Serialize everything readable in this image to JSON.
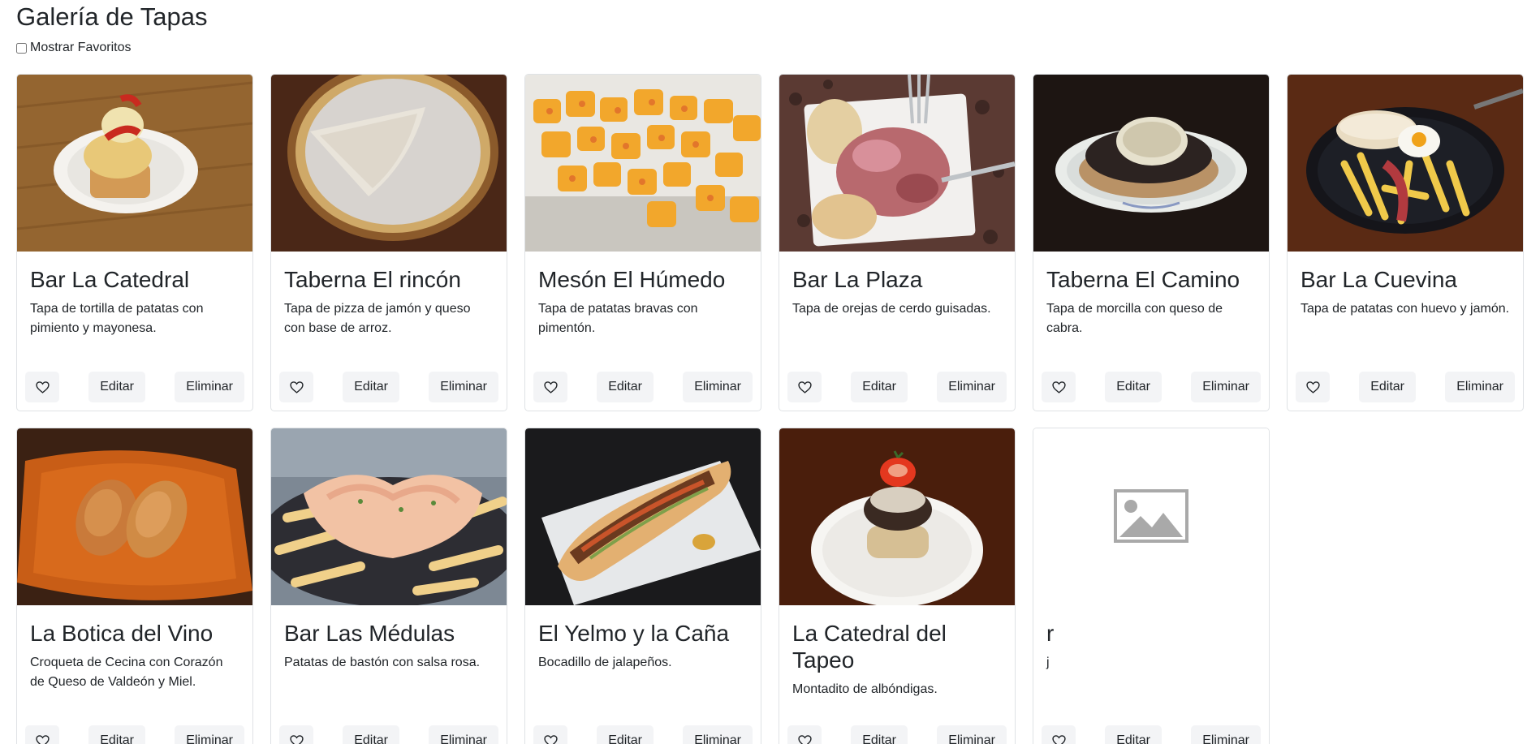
{
  "page": {
    "title": "Galería de Tapas",
    "favorites_filter_label": "Mostrar Favoritos",
    "favorites_filter_checked": false
  },
  "buttons": {
    "favorite_icon": "heart-outline-icon",
    "edit_label": "Editar",
    "delete_label": "Eliminar"
  },
  "cards": [
    {
      "name": "Bar La Catedral",
      "description": "Tapa de tortilla de patatas con pimiento y mayonesa.",
      "image": "tortilla-tapa-photo"
    },
    {
      "name": "Taberna El rincón",
      "description": "Tapa de pizza de jamón y queso con base de arroz.",
      "image": "pizza-tapa-photo"
    },
    {
      "name": "Mesón El Húmedo",
      "description": "Tapa de patatas bravas con pimentón.",
      "image": "patatas-bravas-photo"
    },
    {
      "name": "Bar La Plaza",
      "description": "Tapa de orejas de cerdo guisadas.",
      "image": "orejas-de-cerdo-photo"
    },
    {
      "name": "Taberna El Camino",
      "description": "Tapa de morcilla con queso de cabra.",
      "image": "morcilla-queso-photo"
    },
    {
      "name": "Bar La Cuevina",
      "description": "Tapa de patatas con huevo y jamón.",
      "image": "patatas-huevo-jamon-photo"
    },
    {
      "name": "La Botica del Vino",
      "description": "Croqueta de Cecina con Corazón de Queso de Valdeón y Miel.",
      "image": "croquetas-photo"
    },
    {
      "name": "Bar Las Médulas",
      "description": "Patatas de bastón con salsa rosa.",
      "image": "patatas-salsa-rosa-photo"
    },
    {
      "name": "El Yelmo y la Caña",
      "description": "Bocadillo de jalapeños.",
      "image": "bocadillo-photo"
    },
    {
      "name": "La Catedral del Tapeo",
      "description": "Montadito de albóndigas.",
      "image": "montadito-photo"
    },
    {
      "name": "r",
      "description": "j",
      "image": "image-placeholder-icon"
    }
  ]
}
